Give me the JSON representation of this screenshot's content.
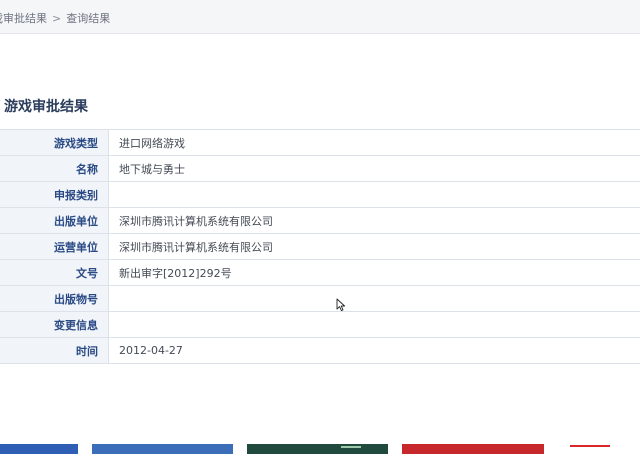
{
  "breadcrumb": {
    "items": [
      "戏审批结果",
      "查询结果"
    ],
    "separator": ">"
  },
  "section_title": "游戏审批结果",
  "rows": [
    {
      "label": "游戏类型",
      "value": "进口网络游戏"
    },
    {
      "label": "名称",
      "value": "地下城与勇士"
    },
    {
      "label": "申报类别",
      "value": ""
    },
    {
      "label": "出版单位",
      "value": "深圳市腾讯计算机系统有限公司"
    },
    {
      "label": "运营单位",
      "value": "深圳市腾讯计算机系统有限公司"
    },
    {
      "label": "文号",
      "value": "新出审字[2012]292号"
    },
    {
      "label": "出版物号",
      "value": ""
    },
    {
      "label": "变更信息",
      "value": ""
    },
    {
      "label": "时间",
      "value": "2012-04-27"
    }
  ],
  "colors": {
    "label_text": "#2a4a86",
    "label_bg": "#f1f4f8",
    "title_text": "#2b3d5c",
    "value_text": "#444a55",
    "border": "#dde2ea"
  },
  "icons": {
    "cursor": "mouse-pointer-icon"
  }
}
